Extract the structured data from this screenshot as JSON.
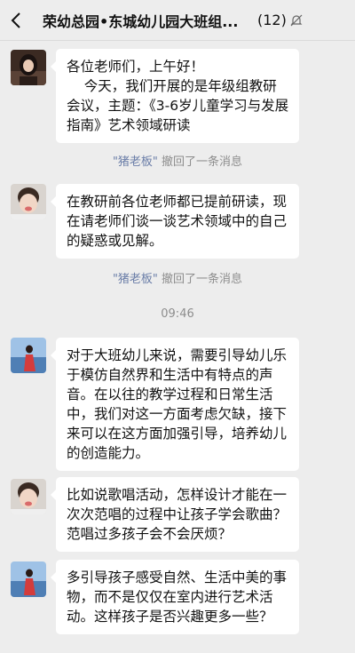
{
  "header": {
    "back_icon": "chevron-left-icon",
    "title": "荣幼总园•东城幼儿园大班组...",
    "member_count": "(12)",
    "mute_icon": "mute-bell-icon"
  },
  "messages": [
    {
      "avatar": "avatar-girl-dark",
      "text": "各位老师们，上午好！\n    今天，我们开展的是年级组教研会议，主题：《3-6岁儿童学习与发展指南》艺术领域研读"
    },
    {
      "avatar": "avatar-child",
      "text": "在教研前各位老师都已提前研读，现在请老师们谈一谈艺术领域中的自己的疑惑或见解。"
    },
    {
      "avatar": "avatar-red-dress",
      "text": "对于大班幼儿来说，需要引导幼儿乐于模仿自然界和生活中有特点的声音。在以往的教学过程和日常生活中，我们对这一方面考虑欠缺，接下来可以在这方面加强引导，培养幼儿的创造能力。"
    },
    {
      "avatar": "avatar-child",
      "text": "比如说歌唱活动，怎样设计才能在一次次范唱的过程中让孩子学会歌曲？范唱过多孩子会不会厌烦？"
    },
    {
      "avatar": "avatar-red-dress",
      "text": "多引导孩子感受自然、生活中美的事物，而不是仅仅在室内进行艺术活动。这样孩子是否兴趣更多一些？"
    }
  ],
  "system": {
    "recall_1": {
      "name": "\"猪老板\"",
      "text": " 撤回了一条消息"
    },
    "recall_2": {
      "name": "\"猪老板\"",
      "text": " 撤回了一条消息"
    },
    "time": "09:46"
  }
}
